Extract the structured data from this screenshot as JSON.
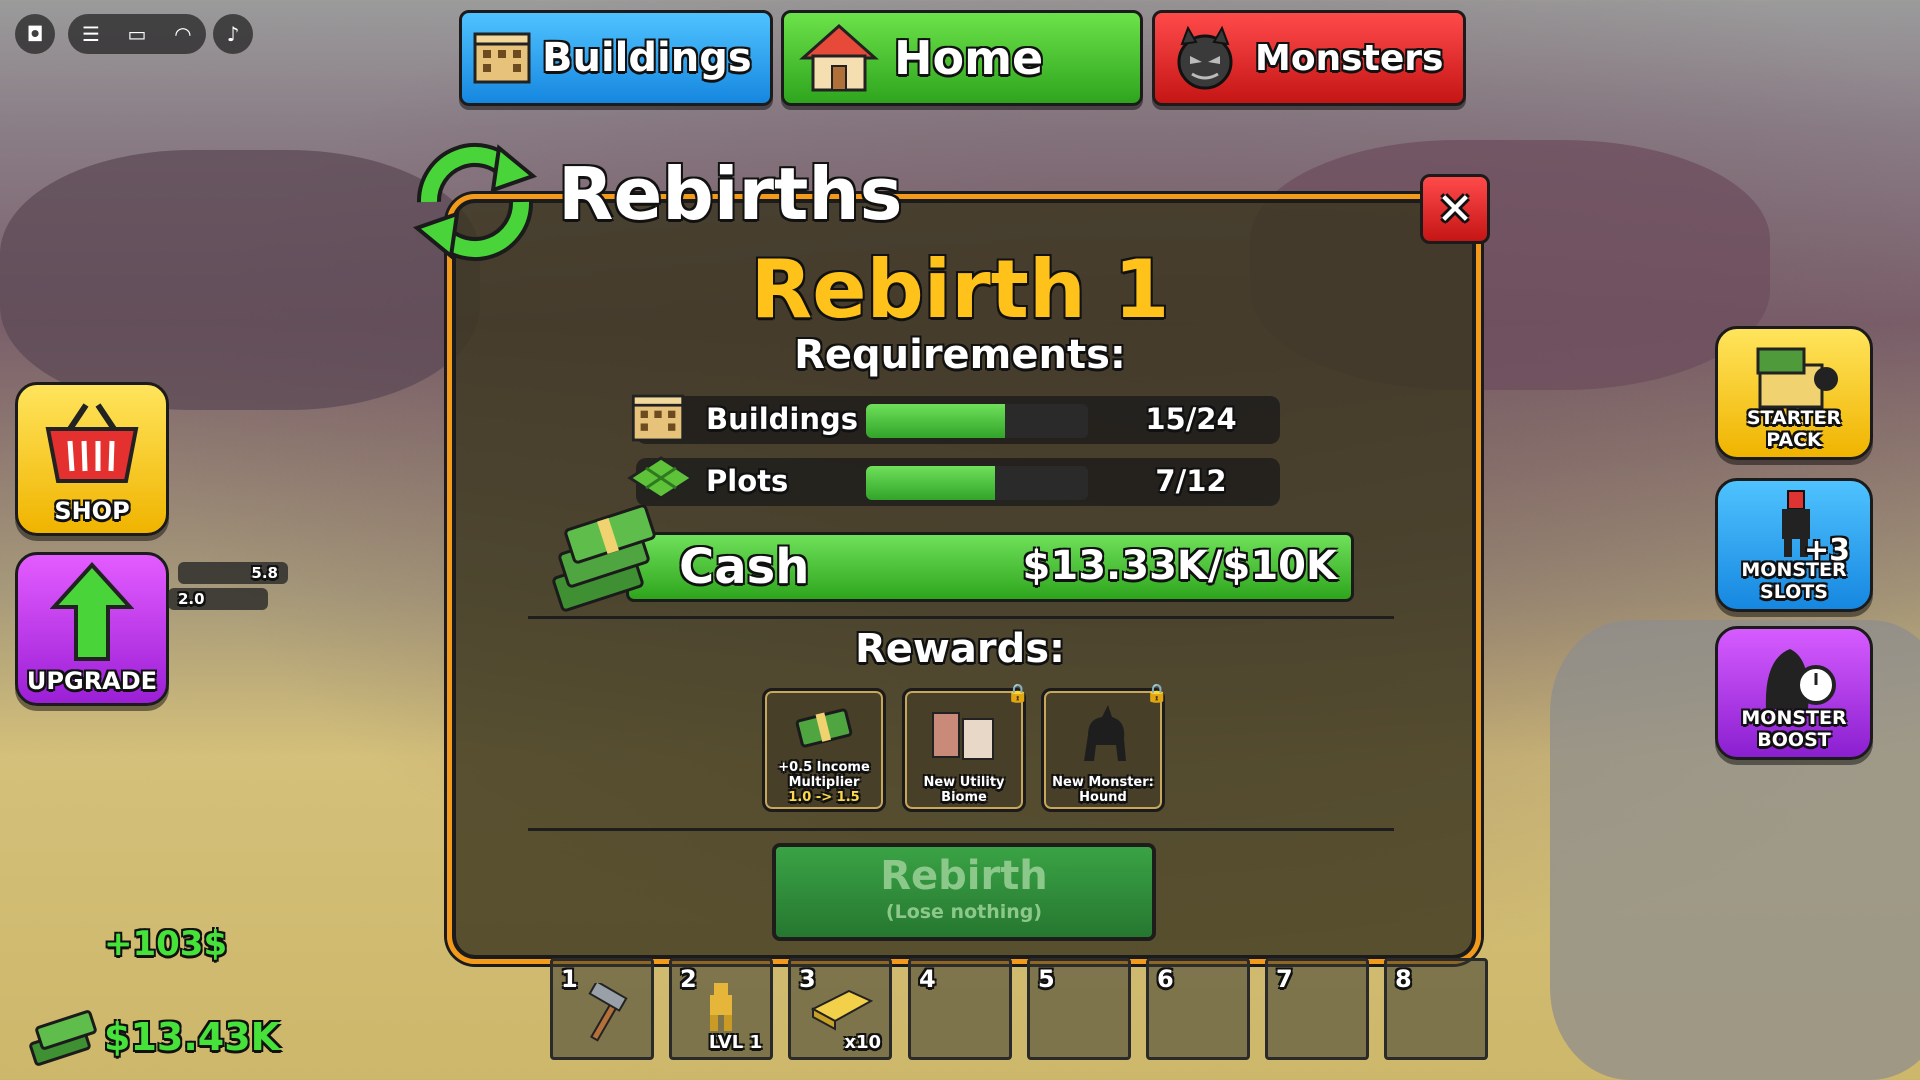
{
  "topbar": {
    "icons": [
      "roblox-logo-icon",
      "menu-icon",
      "chat-icon",
      "headset-icon",
      "music-icon"
    ]
  },
  "nav": {
    "buildings": "Buildings",
    "home": "Home",
    "monsters": "Monsters"
  },
  "side": {
    "shop": "SHOP",
    "upgrade": "UPGRADE",
    "starter_pack": "STARTER PACK",
    "monster_slots": "MONSTER SLOTS",
    "monster_slots_badge": "+3",
    "monster_boost": "MONSTER BOOST"
  },
  "world_tags": {
    "tag1": "5.8",
    "tag2": "2.0"
  },
  "panel": {
    "title": "Rebirths",
    "heading": "Rebirth 1",
    "requirements_title": "Requirements:",
    "requirements": [
      {
        "label": "Buildings",
        "value": "15/24",
        "progress": 0.625
      },
      {
        "label": "Plots",
        "value": "7/12",
        "progress": 0.583
      }
    ],
    "cash": {
      "label": "Cash",
      "value": "$13.33K/$10K",
      "progress": 1.0
    },
    "rewards_title": "Rewards:",
    "rewards": [
      {
        "line1": "+0.5 Income",
        "line2": "Multiplier",
        "line3": "1.0 -> 1.5",
        "locked": false
      },
      {
        "line1": "New Utility",
        "line2": "Biome",
        "line3": "",
        "locked": true
      },
      {
        "line1": "New Monster:",
        "line2": "Hound",
        "line3": "",
        "locked": true
      }
    ],
    "rebirth_button": "Rebirth",
    "rebirth_sub": "(Lose nothing)",
    "close": "✕"
  },
  "hotbar": [
    {
      "num": "1",
      "count": ""
    },
    {
      "num": "2",
      "count": "LVL 1"
    },
    {
      "num": "3",
      "count": "x10"
    },
    {
      "num": "4",
      "count": ""
    },
    {
      "num": "5",
      "count": ""
    },
    {
      "num": "6",
      "count": ""
    },
    {
      "num": "7",
      "count": ""
    },
    {
      "num": "8",
      "count": ""
    }
  ],
  "hud": {
    "income_popup": "+103$",
    "money": "$13.43K"
  },
  "colors": {
    "accent_orange": "#f39a1a",
    "gold": "#ffc21a",
    "green": "#46e23a"
  }
}
